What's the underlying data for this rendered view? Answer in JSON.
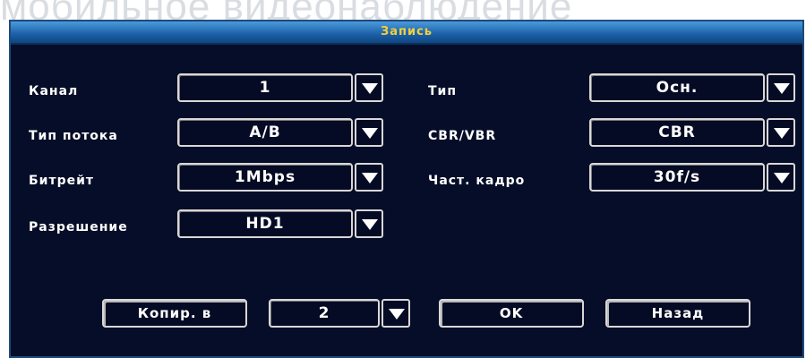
{
  "background_watermark": "мобильное видеонаблюдение",
  "dialog": {
    "title": "Запись"
  },
  "fields": {
    "channel": {
      "label": "Канал",
      "value": "1"
    },
    "type": {
      "label": "Тип",
      "value": "Осн."
    },
    "stream_type": {
      "label": "Тип потока",
      "value": "А/В"
    },
    "cbr_vbr": {
      "label": "CBR/VBR",
      "value": "CBR"
    },
    "bitrate": {
      "label": "Битрейт",
      "value": "1Mbps"
    },
    "frame_rate": {
      "label": "Част. кадро",
      "value": "30f/s"
    },
    "resolution": {
      "label": "Разрешение",
      "value": "HD1"
    }
  },
  "footer": {
    "copy_to_label": "Копир. в",
    "copy_target_value": "2",
    "ok_label": "OK",
    "back_label": "Назад"
  },
  "colors": {
    "dialog_bg": "#060d28",
    "titlebar": "#1c5fa6",
    "title_text": "#f2d13a",
    "text": "#ffffff",
    "border": "#d8d8d8"
  },
  "icons": {
    "dropdown": "triangle-down-icon"
  }
}
